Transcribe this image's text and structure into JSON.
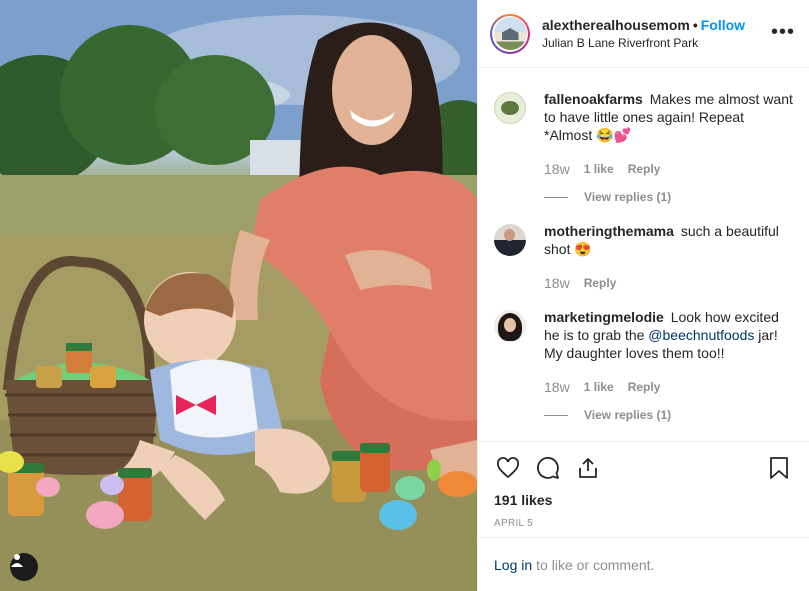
{
  "post": {
    "username": "alextherealhousemom",
    "separator": "•",
    "follow_label": "Follow",
    "location": "Julian B Lane Riverfront Park",
    "more_icon": "more-options-icon"
  },
  "comments": [
    {
      "username": "fallenoakfarms",
      "text": "Makes me almost want to have little ones again! Repeat *Almost 😂💕",
      "age": "18w",
      "likes": "1 like",
      "reply_label": "Reply",
      "view_replies": "View replies (1)"
    },
    {
      "username": "motheringthemama",
      "text": "such a beautiful shot 😍",
      "age": "18w",
      "reply_label": "Reply"
    },
    {
      "username": "marketingmelodie",
      "text_before": "Look how excited he is to grab the ",
      "mention": "@beechnutfoods",
      "text_after": " jar! My daughter loves them too!!",
      "age": "18w",
      "likes": "1 like",
      "reply_label": "Reply",
      "view_replies": "View replies (1)"
    }
  ],
  "actions": {
    "like_icon": "heart-icon",
    "comment_icon": "comment-icon",
    "share_icon": "share-icon",
    "save_icon": "bookmark-icon",
    "likes_count": "191 likes",
    "date": "APRIL 5"
  },
  "login": {
    "login_label": "Log in",
    "rest": "to like or comment."
  }
}
